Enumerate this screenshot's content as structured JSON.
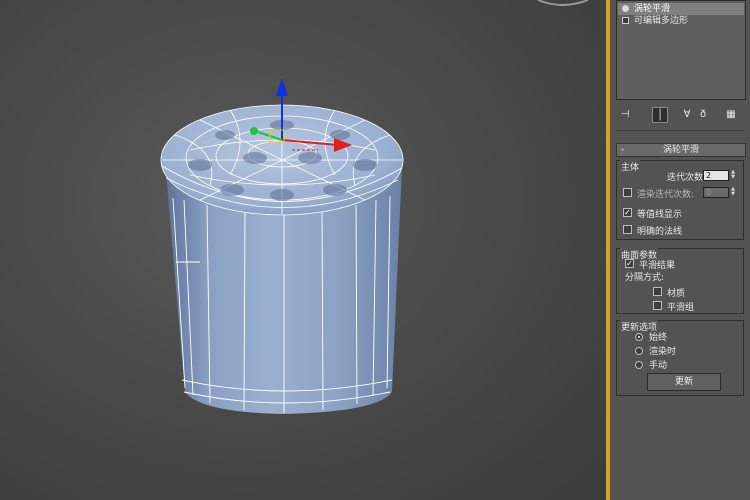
{
  "modifier_stack": {
    "items": [
      {
        "label": "涡轮平滑",
        "selected": true,
        "icon": "bulb-icon"
      },
      {
        "label": "可编辑多边形",
        "selected": false,
        "icon": "plus-icon"
      }
    ]
  },
  "stack_tools": [
    "pin-stack-icon",
    "show-end-result-icon",
    "make-unique-icon",
    "remove-modifier-icon",
    "configure-sets-icon"
  ],
  "turbosmooth": {
    "rollout_title": "涡轮平滑",
    "main": {
      "group_label": "主体",
      "iterations_label": "迭代次数:",
      "iterations_value": "2",
      "render_iters_label": "渲染迭代次数:",
      "render_iters_value": "0",
      "render_iters_checked": false,
      "isoline_label": "等值线显示",
      "isoline_checked": true,
      "explicit_normals_label": "明确的法线",
      "explicit_normals_checked": false
    },
    "surface": {
      "group_label": "曲面参数",
      "smooth_result_label": "平滑结果",
      "smooth_result_checked": true,
      "separate_by_label": "分隔方式:",
      "materials_label": "材质",
      "materials_checked": false,
      "smoothing_groups_label": "平滑组",
      "smoothing_groups_checked": false
    },
    "update": {
      "group_label": "更新选项",
      "options": [
        "始终",
        "渲染时",
        "手动"
      ],
      "selected_index": 0,
      "button_label": "更新"
    }
  },
  "colors": {
    "panel_accent": "#d9a21f",
    "mesh": "#8fa6c6",
    "wire": "#ffffff",
    "gizmo_x": "#e02020",
    "gizmo_y": "#20c040",
    "gizmo_z": "#1030e0"
  }
}
